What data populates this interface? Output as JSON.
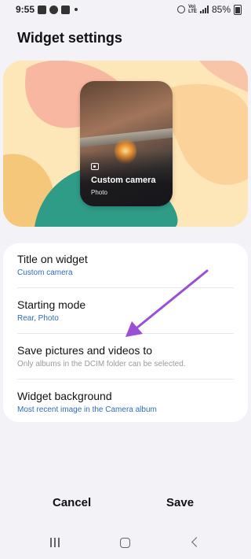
{
  "status_bar": {
    "time": "9:55",
    "volte_label": "Vo))\nLTE",
    "battery": "85%"
  },
  "page_title": "Widget settings",
  "preview": {
    "widget_title": "Custom camera",
    "widget_subtitle": "Photo"
  },
  "settings": [
    {
      "label": "Title on widget",
      "value": "Custom camera"
    },
    {
      "label": "Starting mode",
      "value": "Rear, Photo"
    },
    {
      "label": "Save pictures and videos to",
      "value": "Only albums in the DCIM folder can be selected."
    },
    {
      "label": "Widget background",
      "value": "Most recent image in the Camera album"
    }
  ],
  "actions": {
    "cancel": "Cancel",
    "save": "Save"
  },
  "colors": {
    "accent_link": "#2f6bc1",
    "annotation_arrow": "#9b4fd6",
    "background": "#f3f2f7"
  }
}
